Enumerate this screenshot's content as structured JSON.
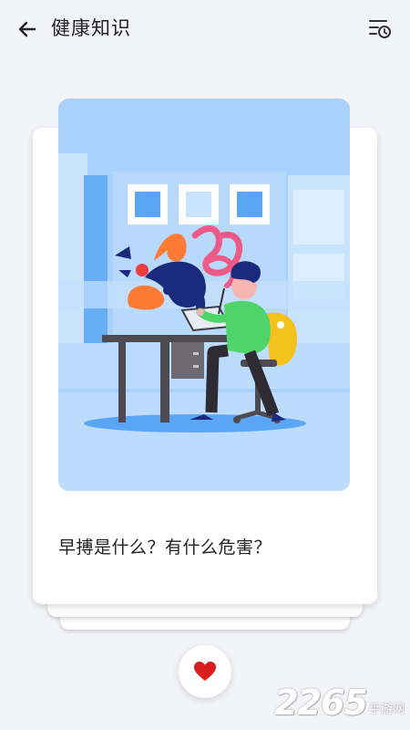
{
  "header": {
    "title": "健康知识",
    "back_icon": "arrow-left-icon",
    "history_icon": "list-history-icon"
  },
  "card": {
    "title": "早搏是什么？有什么危害？",
    "illustration": "person-drawing-at-desk-illustration"
  },
  "actions": {
    "like_icon": "heart-icon",
    "like_color": "#d81e1e"
  },
  "watermark": {
    "number": "2265",
    "text": "手游网"
  },
  "colors": {
    "background": "#f3f4f8",
    "illustration_bg": "#a9d1fb",
    "accent_green": "#4fd46a",
    "accent_yellow": "#f4c21d",
    "accent_navy": "#1b2a7c",
    "accent_pink": "#ee5a86",
    "accent_orange": "#ff7a35"
  }
}
